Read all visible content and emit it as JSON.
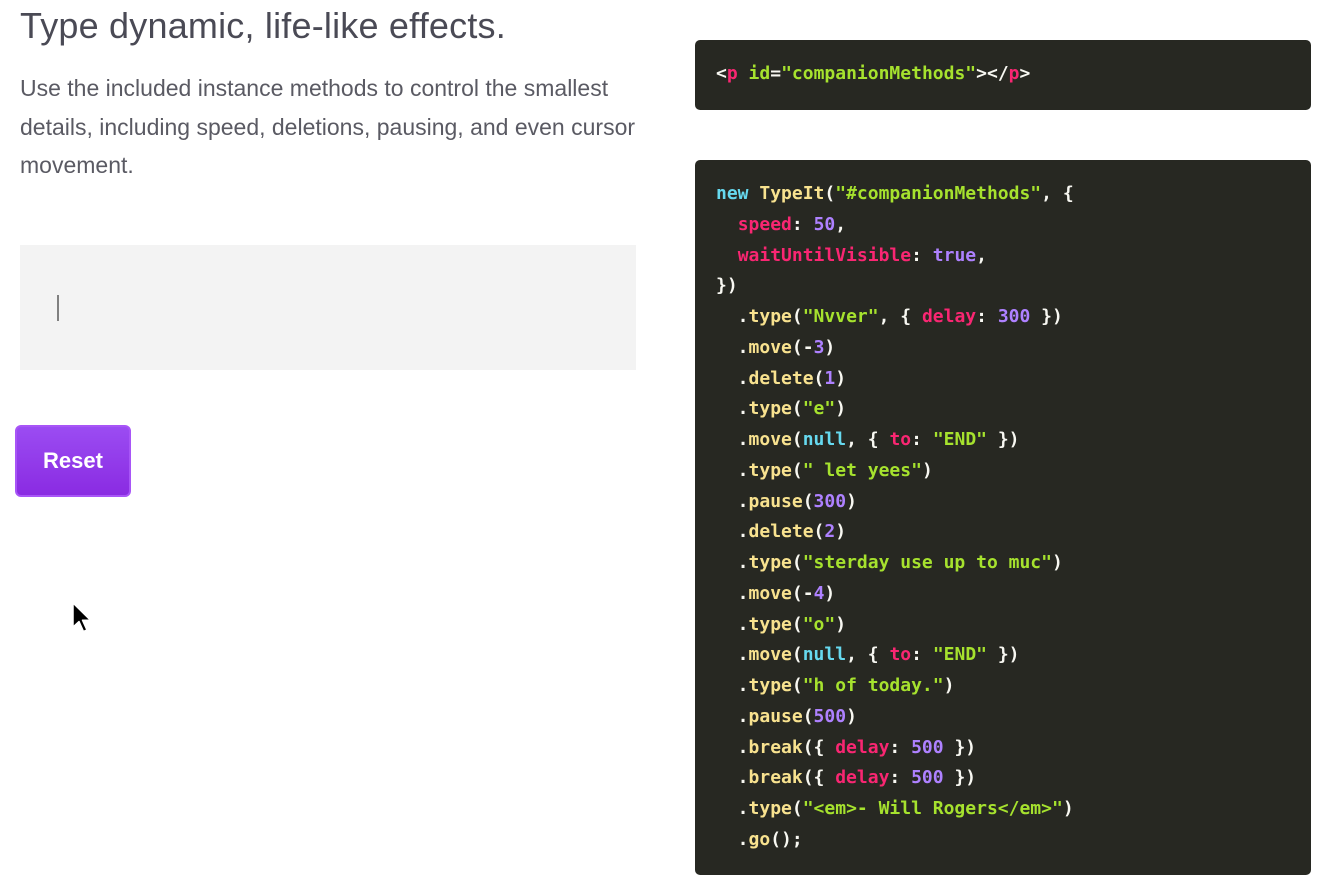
{
  "headline": "Type dynamic, life-like effects.",
  "description": "Use the included instance methods to control the smallest details, including speed, deletions, pausing, and even cursor movement.",
  "demo": {
    "text": ""
  },
  "reset_button": {
    "label": "Reset",
    "colors": {
      "fill": "#9b4cf2",
      "border": "#a855f7"
    }
  },
  "code_theme": {
    "background": "#272822",
    "keyword": "#66d9ef",
    "function": "#f8e28f",
    "string": "#a6e22e",
    "property": "#f92672",
    "number": "#ae81ff"
  },
  "html_snippet": {
    "tag_open": "<",
    "tag_name": "p",
    "attr_name": "id",
    "equals": "=",
    "attr_value": "\"companionMethods\"",
    "close_open": "></",
    "close_tag": "p",
    "tag_end": ">"
  },
  "js_snippet": {
    "lines": [
      [
        [
          "kw",
          "new "
        ],
        [
          "fn",
          "TypeIt"
        ],
        [
          "pl",
          "("
        ],
        [
          "str",
          "\"#companionMethods\""
        ],
        [
          "pl",
          ", {"
        ]
      ],
      [
        [
          "pl",
          "  "
        ],
        [
          "prop",
          "speed"
        ],
        [
          "pl",
          ": "
        ],
        [
          "num",
          "50"
        ],
        [
          "pl",
          ","
        ]
      ],
      [
        [
          "pl",
          "  "
        ],
        [
          "prop",
          "waitUntilVisible"
        ],
        [
          "pl",
          ": "
        ],
        [
          "num",
          "true"
        ],
        [
          "pl",
          ","
        ]
      ],
      [
        [
          "pl",
          "})"
        ]
      ],
      [
        [
          "pl",
          "  ."
        ],
        [
          "mth",
          "type"
        ],
        [
          "pl",
          "("
        ],
        [
          "str",
          "\"Nvver\""
        ],
        [
          "pl",
          ", { "
        ],
        [
          "prop",
          "delay"
        ],
        [
          "pl",
          ": "
        ],
        [
          "num",
          "300"
        ],
        [
          "pl",
          " })"
        ]
      ],
      [
        [
          "pl",
          "  ."
        ],
        [
          "mth",
          "move"
        ],
        [
          "pl",
          "(-"
        ],
        [
          "num",
          "3"
        ],
        [
          "pl",
          ")"
        ]
      ],
      [
        [
          "pl",
          "  ."
        ],
        [
          "mth",
          "delete"
        ],
        [
          "pl",
          "("
        ],
        [
          "num",
          "1"
        ],
        [
          "pl",
          ")"
        ]
      ],
      [
        [
          "pl",
          "  ."
        ],
        [
          "mth",
          "type"
        ],
        [
          "pl",
          "("
        ],
        [
          "str",
          "\"e\""
        ],
        [
          "pl",
          ")"
        ]
      ],
      [
        [
          "pl",
          "  ."
        ],
        [
          "mth",
          "move"
        ],
        [
          "pl",
          "("
        ],
        [
          "kw",
          "null"
        ],
        [
          "pl",
          ", { "
        ],
        [
          "prop",
          "to"
        ],
        [
          "pl",
          ": "
        ],
        [
          "str",
          "\"END\""
        ],
        [
          "pl",
          " })"
        ]
      ],
      [
        [
          "pl",
          "  ."
        ],
        [
          "mth",
          "type"
        ],
        [
          "pl",
          "("
        ],
        [
          "str",
          "\" let yees\""
        ],
        [
          "pl",
          ")"
        ]
      ],
      [
        [
          "pl",
          "  ."
        ],
        [
          "mth",
          "pause"
        ],
        [
          "pl",
          "("
        ],
        [
          "num",
          "300"
        ],
        [
          "pl",
          ")"
        ]
      ],
      [
        [
          "pl",
          "  ."
        ],
        [
          "mth",
          "delete"
        ],
        [
          "pl",
          "("
        ],
        [
          "num",
          "2"
        ],
        [
          "pl",
          ")"
        ]
      ],
      [
        [
          "pl",
          "  ."
        ],
        [
          "mth",
          "type"
        ],
        [
          "pl",
          "("
        ],
        [
          "str",
          "\"sterday use up to muc\""
        ],
        [
          "pl",
          ")"
        ]
      ],
      [
        [
          "pl",
          "  ."
        ],
        [
          "mth",
          "move"
        ],
        [
          "pl",
          "(-"
        ],
        [
          "num",
          "4"
        ],
        [
          "pl",
          ")"
        ]
      ],
      [
        [
          "pl",
          "  ."
        ],
        [
          "mth",
          "type"
        ],
        [
          "pl",
          "("
        ],
        [
          "str",
          "\"o\""
        ],
        [
          "pl",
          ")"
        ]
      ],
      [
        [
          "pl",
          "  ."
        ],
        [
          "mth",
          "move"
        ],
        [
          "pl",
          "("
        ],
        [
          "kw",
          "null"
        ],
        [
          "pl",
          ", { "
        ],
        [
          "prop",
          "to"
        ],
        [
          "pl",
          ": "
        ],
        [
          "str",
          "\"END\""
        ],
        [
          "pl",
          " })"
        ]
      ],
      [
        [
          "pl",
          "  ."
        ],
        [
          "mth",
          "type"
        ],
        [
          "pl",
          "("
        ],
        [
          "str",
          "\"h of today.\""
        ],
        [
          "pl",
          ")"
        ]
      ],
      [
        [
          "pl",
          "  ."
        ],
        [
          "mth",
          "pause"
        ],
        [
          "pl",
          "("
        ],
        [
          "num",
          "500"
        ],
        [
          "pl",
          ")"
        ]
      ],
      [
        [
          "pl",
          "  ."
        ],
        [
          "mth",
          "break"
        ],
        [
          "pl",
          "({ "
        ],
        [
          "prop",
          "delay"
        ],
        [
          "pl",
          ": "
        ],
        [
          "num",
          "500"
        ],
        [
          "pl",
          " })"
        ]
      ],
      [
        [
          "pl",
          "  ."
        ],
        [
          "mth",
          "break"
        ],
        [
          "pl",
          "({ "
        ],
        [
          "prop",
          "delay"
        ],
        [
          "pl",
          ": "
        ],
        [
          "num",
          "500"
        ],
        [
          "pl",
          " })"
        ]
      ],
      [
        [
          "pl",
          "  ."
        ],
        [
          "mth",
          "type"
        ],
        [
          "pl",
          "("
        ],
        [
          "str",
          "\"<em>- Will Rogers</em>\""
        ],
        [
          "pl",
          ")"
        ]
      ],
      [
        [
          "pl",
          "  ."
        ],
        [
          "mth",
          "go"
        ],
        [
          "pl",
          "();"
        ]
      ]
    ]
  },
  "icons": {
    "pointer": "mouse-pointer-icon",
    "caret": "text-cursor-icon"
  }
}
